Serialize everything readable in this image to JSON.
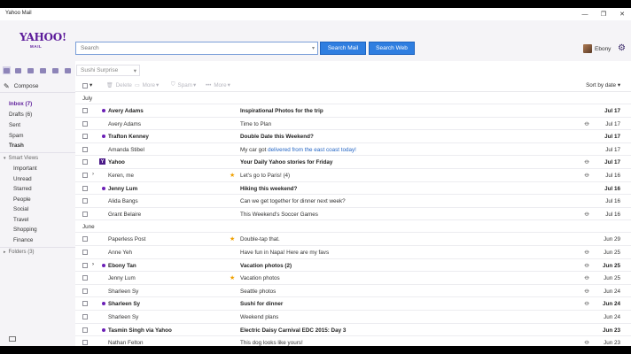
{
  "window": {
    "title": "Yahoo Mail",
    "min_glyph": "—",
    "max_glyph": "❐",
    "close_glyph": "✕"
  },
  "header": {
    "logo": "YAHOO!",
    "logo_sub": "MAIL",
    "search_placeholder": "Search",
    "search_mail_label": "Search Mail",
    "search_web_label": "Search Web",
    "user_name": "Ebony",
    "theme_select": "Sushi Surprise"
  },
  "colors": {
    "brand": "#5c1b9a",
    "accent": "#2f7ee0",
    "unread_dot": "#6b1fb6",
    "star": "#f0a000"
  },
  "sidebar": {
    "compose_label": "Compose",
    "folders": [
      {
        "label": "Inbox (7)",
        "active": true
      },
      {
        "label": "Drafts (6)"
      },
      {
        "label": "Sent"
      },
      {
        "label": "Spam"
      },
      {
        "label": "Trash",
        "bold": true
      }
    ],
    "smart_views_label": "Smart Views",
    "smart_views": [
      "Important",
      "Unread",
      "Starred",
      "People",
      "Social",
      "Travel",
      "Shopping",
      "Finance"
    ],
    "folders_section_label": "Folders (3)"
  },
  "toolbar": {
    "delete_label": "Delete",
    "move_label": "More",
    "spam_label": "Spam",
    "more_label": "More",
    "sort_label": "Sort by date"
  },
  "list": {
    "groups": [
      "July",
      "June"
    ],
    "rows": [
      {
        "sender": "Avery Adams",
        "subject": "Inspirational Photos for the trip",
        "date": "Jul 17",
        "unread": true,
        "dot": true,
        "attach": false,
        "star": false,
        "expand": false
      },
      {
        "sender": "Avery Adams",
        "subject": "Time to Plan",
        "date": "Jul 17",
        "unread": false,
        "dot": false,
        "attach": true,
        "star": false,
        "expand": false
      },
      {
        "sender": "Trafton Kenney",
        "subject": "Double Date this Weekend?",
        "date": "Jul 17",
        "unread": true,
        "dot": true,
        "attach": false,
        "star": false,
        "expand": false
      },
      {
        "sender": "Amanda Stibel",
        "subject_pre": "My car got ",
        "subject_link": "delivered from the east coast today!",
        "date": "Jul 17",
        "unread": false,
        "dot": false,
        "attach": false,
        "star": false,
        "expand": false
      },
      {
        "sender": "Yahoo",
        "subject": "Your Daily Yahoo stories for Friday",
        "date": "Jul 17",
        "unread": true,
        "dot": false,
        "yicon": true,
        "attach": true,
        "star": false,
        "expand": false
      },
      {
        "sender": "Keren, me",
        "subject": "Let's go to Paris! (4)",
        "date": "Jul 16",
        "unread": false,
        "dot": false,
        "attach": true,
        "star": true,
        "expand": true
      },
      {
        "sender": "Jenny Lum",
        "subject": "Hiking this weekend?",
        "date": "Jul 16",
        "unread": true,
        "dot": true,
        "attach": false,
        "star": false,
        "expand": false
      },
      {
        "sender": "Alida Bangs",
        "subject": "Can we get together for dinner next week?",
        "date": "Jul 16",
        "unread": false,
        "dot": false,
        "attach": false,
        "star": false,
        "expand": false
      },
      {
        "sender": "Grant Belaire",
        "subject": "This Weekend's Soccer Games",
        "date": "Jul 16",
        "unread": false,
        "dot": false,
        "attach": true,
        "star": false,
        "expand": false
      },
      {
        "sender": "Paperless Post",
        "subject": "Double-tap that.",
        "date": "Jun 29",
        "unread": false,
        "dot": false,
        "attach": false,
        "star": true,
        "expand": false
      },
      {
        "sender": "Anne Yeh",
        "subject": "Have fun in Napa! Here are my favs",
        "date": "Jun 25",
        "unread": false,
        "dot": false,
        "attach": true,
        "star": false,
        "expand": false
      },
      {
        "sender": "Ebony Tan",
        "subject": "Vacation photos (2)",
        "date": "Jun 25",
        "unread": true,
        "dot": true,
        "attach": true,
        "star": false,
        "expand": true
      },
      {
        "sender": "Jenny Lum",
        "subject": "Vacation photos",
        "date": "Jun 25",
        "unread": false,
        "dot": false,
        "attach": true,
        "star": true,
        "expand": false
      },
      {
        "sender": "Sharleen Sy",
        "subject": "Seattle photos",
        "date": "Jun 24",
        "unread": false,
        "dot": false,
        "attach": true,
        "star": false,
        "expand": false
      },
      {
        "sender": "Sharleen Sy",
        "subject": "Sushi for dinner",
        "date": "Jun 24",
        "unread": true,
        "dot": true,
        "attach": true,
        "star": false,
        "expand": false
      },
      {
        "sender": "Sharleen Sy",
        "subject": "Weekend plans",
        "date": "Jun 24",
        "unread": false,
        "dot": false,
        "attach": false,
        "star": false,
        "expand": false
      },
      {
        "sender": "Tasmin Singh via Yahoo",
        "subject": "Electric Daisy Carnival EDC 2015: Day 3",
        "date": "Jun 23",
        "unread": true,
        "dot": true,
        "attach": false,
        "star": false,
        "expand": false
      },
      {
        "sender": "Nathan Felton",
        "subject": "This dog looks like yours!",
        "date": "Jun 23",
        "unread": false,
        "dot": false,
        "attach": true,
        "star": false,
        "expand": false
      }
    ]
  }
}
